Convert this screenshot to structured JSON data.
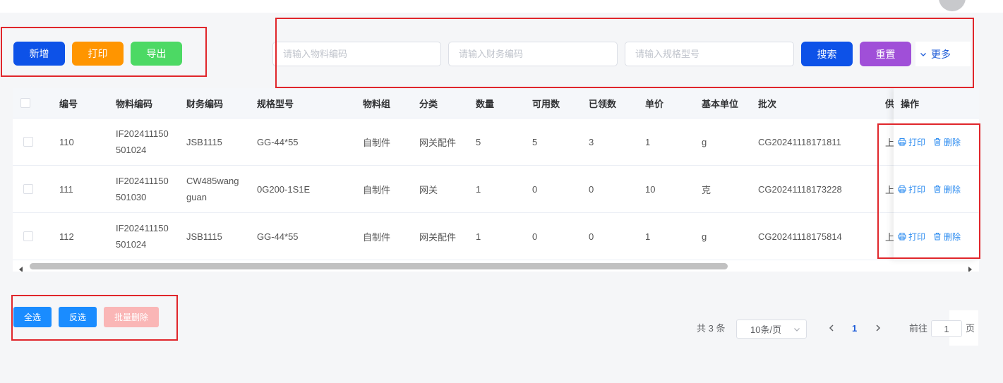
{
  "toolbar": {
    "add_label": "新增",
    "print_label": "打印",
    "export_label": "导出"
  },
  "search": {
    "material_code_placeholder": "请输入物料编码",
    "finance_code_placeholder": "请输入财务编码",
    "spec_placeholder": "请输入规格型号",
    "search_label": "搜索",
    "reset_label": "重置",
    "more_label": "更多"
  },
  "table": {
    "columns": [
      "编号",
      "物料编码",
      "财务编码",
      "规格型号",
      "物料组",
      "分类",
      "数量",
      "可用数",
      "已领数",
      "单价",
      "基本单位",
      "批次",
      "供"
    ],
    "action_header": "操作",
    "actions": {
      "print_label": "打印",
      "delete_label": "删除"
    },
    "rows": [
      {
        "id": 110,
        "material_code": "IF202411150501024",
        "finance_code": "JSB1115",
        "spec": "GG-44*55",
        "material_group": "自制件",
        "category": "网关配件",
        "quantity": 5,
        "available": 5,
        "received": 3,
        "unit_price": 1,
        "base_unit": "g",
        "batch": "CG20241118171811",
        "supplier": "上"
      },
      {
        "id": 111,
        "material_code": "IF202411150501030",
        "finance_code": "CW485wangguan",
        "spec": "0G200-1S1E",
        "material_group": "自制件",
        "category": "网关",
        "quantity": 1,
        "available": 0,
        "received": 0,
        "unit_price": 10,
        "base_unit": "克",
        "batch": "CG20241118173228",
        "supplier": "上"
      },
      {
        "id": 112,
        "material_code": "IF202411150501024",
        "finance_code": "JSB1115",
        "spec": "GG-44*55",
        "material_group": "自制件",
        "category": "网关配件",
        "quantity": 1,
        "available": 0,
        "received": 0,
        "unit_price": 1,
        "base_unit": "g",
        "batch": "CG20241118175814",
        "supplier": "上"
      }
    ]
  },
  "bulk_actions": {
    "select_all_label": "全选",
    "invert_label": "反选",
    "batch_delete_label": "批量删除"
  },
  "pagination": {
    "total_text": "共 3 条",
    "page_size": "10条/页",
    "current_page": 1,
    "goto_prefix": "前往",
    "goto_value": "1",
    "goto_suffix": "页"
  },
  "colors": {
    "primary": "#0d52e8",
    "warning": "#ff9500",
    "success": "#4cd964",
    "purple": "#a04fd8",
    "more_link": "#1d5bd8",
    "action_link": "#2d8cf0",
    "bulk_primary": "#1a8cff",
    "disabled_danger": "#fab6b6",
    "current_page": "#1d5bd8",
    "annotation": "#e0262b"
  },
  "icons": {
    "more": "chevron-down-icon",
    "row_print": "printer-icon",
    "row_delete": "trash-icon",
    "page_size": "chevron-down-icon",
    "prev_page": "chevron-left-icon",
    "next_page": "chevron-right-icon"
  }
}
